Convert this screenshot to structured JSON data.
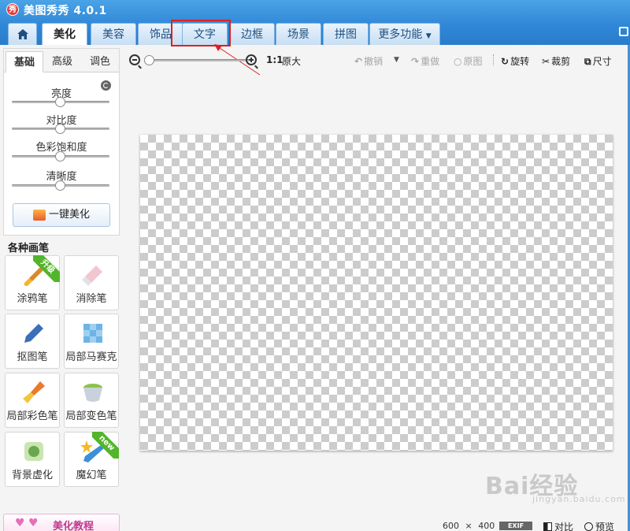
{
  "app": {
    "logo_char": "秀",
    "title": "美图秀秀 4.0.1"
  },
  "tabs": [
    "美化",
    "美容",
    "饰品",
    "文字",
    "边框",
    "场景",
    "拼图",
    "更多功能"
  ],
  "subtabs": [
    "基础",
    "高级",
    "调色"
  ],
  "adjustments": [
    {
      "label": "亮度",
      "value": 0.5
    },
    {
      "label": "对比度",
      "value": 0.5
    },
    {
      "label": "色彩饱和度",
      "value": 0.5
    },
    {
      "label": "清晰度",
      "value": 0.5
    }
  ],
  "one_key_button": "一键美化",
  "brushes_title": "各种画笔",
  "brushes": [
    {
      "label": "涂鸦笔",
      "badge": "升级",
      "icon": "brush-icon"
    },
    {
      "label": "消除笔",
      "badge": "",
      "icon": "eraser-icon"
    },
    {
      "label": "抠图笔",
      "badge": "",
      "icon": "cutout-pen-icon"
    },
    {
      "label": "局部马赛克",
      "badge": "",
      "icon": "mosaic-icon"
    },
    {
      "label": "局部彩色笔",
      "badge": "",
      "icon": "color-brush-icon"
    },
    {
      "label": "局部变色笔",
      "badge": "",
      "icon": "paint-bucket-icon"
    },
    {
      "label": "背景虚化",
      "badge": "",
      "icon": "blur-icon"
    },
    {
      "label": "魔幻笔",
      "badge": "new",
      "icon": "magic-wand-icon"
    }
  ],
  "tutorial_label": "美化教程",
  "toolbar": {
    "zoom_ratio": "1:1",
    "original_size": "原大",
    "undo": "撤销",
    "redo": "重做",
    "original": "原图",
    "rotate": "旋转",
    "crop": "裁剪",
    "resize": "尺寸"
  },
  "status": {
    "width": "600",
    "times": "×",
    "height": "400",
    "exif": "EXIF",
    "compare": "对比",
    "preview": "预览"
  },
  "watermark": {
    "brand": "Bai经验",
    "url": "jingyan.baidu.com"
  },
  "colors": {
    "accent": "#2f86d6",
    "highlight": "#e01f1f",
    "badge_green": "#52b52a"
  }
}
